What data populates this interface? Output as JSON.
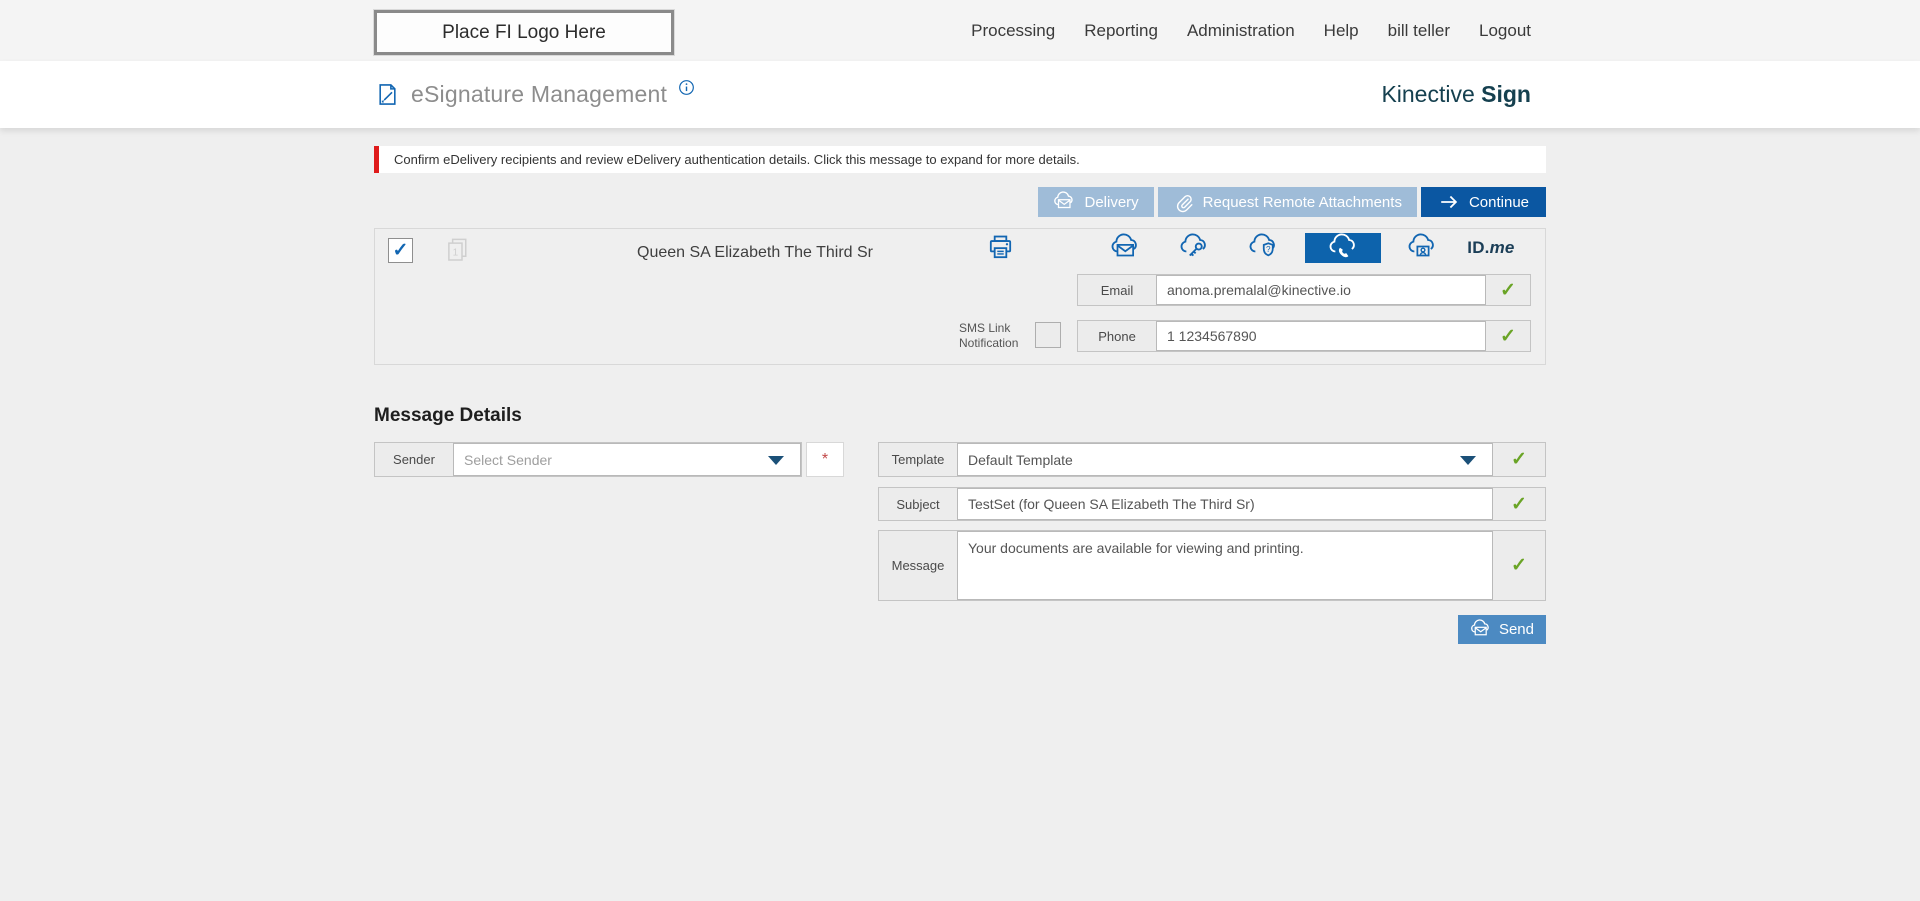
{
  "topbar": {
    "logo_text": "Place FI Logo Here",
    "nav": [
      "Processing",
      "Reporting",
      "Administration",
      "Help",
      "bill teller",
      "Logout"
    ]
  },
  "header": {
    "title": "eSignature Management",
    "brand_name": "Kinective ",
    "brand_product": "Sign"
  },
  "alert": {
    "text": "Confirm eDelivery recipients and review eDelivery authentication details. Click this message to expand for more details."
  },
  "toolbar": {
    "delivery_label": "Delivery",
    "request_remote_attachments_label": "Request Remote Attachments",
    "continue_label": "Continue"
  },
  "recipient": {
    "selected": true,
    "document_count": "1",
    "name": "Queen SA Elizabeth The Third Sr",
    "idme_bold": "ID.",
    "idme_italic": "me",
    "email_label": "Email",
    "email_value": "anoma.premalal@kinective.io",
    "sms_label_line1": "SMS Link",
    "sms_label_line2": "Notification",
    "sms_checked": false,
    "phone_label": "Phone",
    "phone_value": "1 1234567890"
  },
  "message_details": {
    "heading": "Message Details",
    "sender_label": "Sender",
    "sender_placeholder": "Select Sender",
    "required_marker": "*",
    "template_label": "Template",
    "template_value": "Default Template",
    "subject_label": "Subject",
    "subject_value": "TestSet (for Queen SA Elizabeth The Third Sr)",
    "message_label": "Message",
    "message_value": "Your documents are available for viewing and printing.",
    "send_label": "Send"
  },
  "glyphs": {
    "check": "✓"
  },
  "colors": {
    "accent_blue": "#1266b2",
    "dark_blue_button": "#0b57a2",
    "selected_auth_blue": "#0d63ac",
    "light_blue_button": "#9fbcd8",
    "send_button_blue": "#4c8ac2",
    "success_green": "#6aa426",
    "alert_red": "#df1b1b",
    "brand_teal": "#15404f",
    "page_background": "#efefef",
    "topbar_background": "#f4f4f4"
  }
}
